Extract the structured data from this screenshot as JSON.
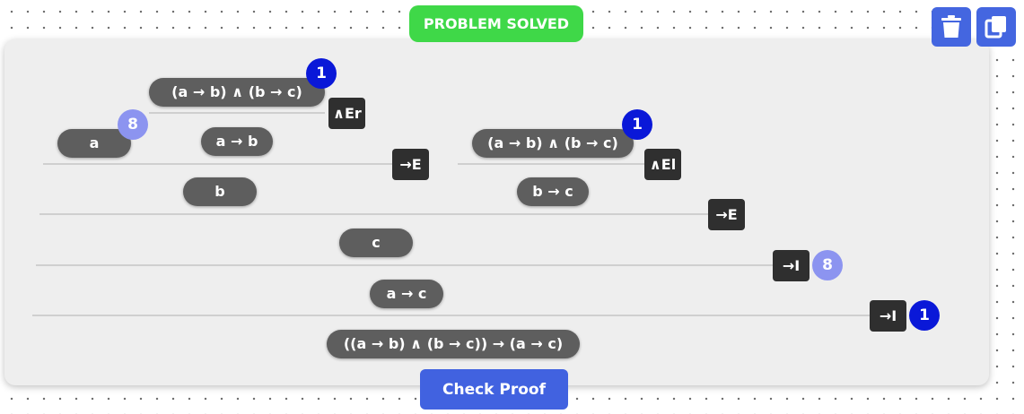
{
  "status": {
    "label": "PROBLEM SOLVED",
    "color": "#3fd848"
  },
  "toolbar": {
    "delete_icon": "trash-icon",
    "copy_icon": "copy-icon"
  },
  "proof": {
    "formulas": {
      "f1": "(a → b) ∧ (b → c)",
      "f2": "a",
      "f3": "a → b",
      "f4": "(a → b) ∧ (b → c)",
      "f5": "b",
      "f6": "b → c",
      "f7": "c",
      "f8": "a → c",
      "f9": "((a → b) ∧ (b → c)) → (a → c)"
    },
    "rules": {
      "r1": "∧Er",
      "r2": "→E",
      "r3": "∧El",
      "r4": "→E",
      "r5": "→I",
      "r6": "→I"
    },
    "badges": {
      "b1": "1",
      "b2": "8",
      "b3": "1",
      "b4": "8",
      "b5": "1"
    }
  },
  "check_button": {
    "label": "Check Proof"
  }
}
